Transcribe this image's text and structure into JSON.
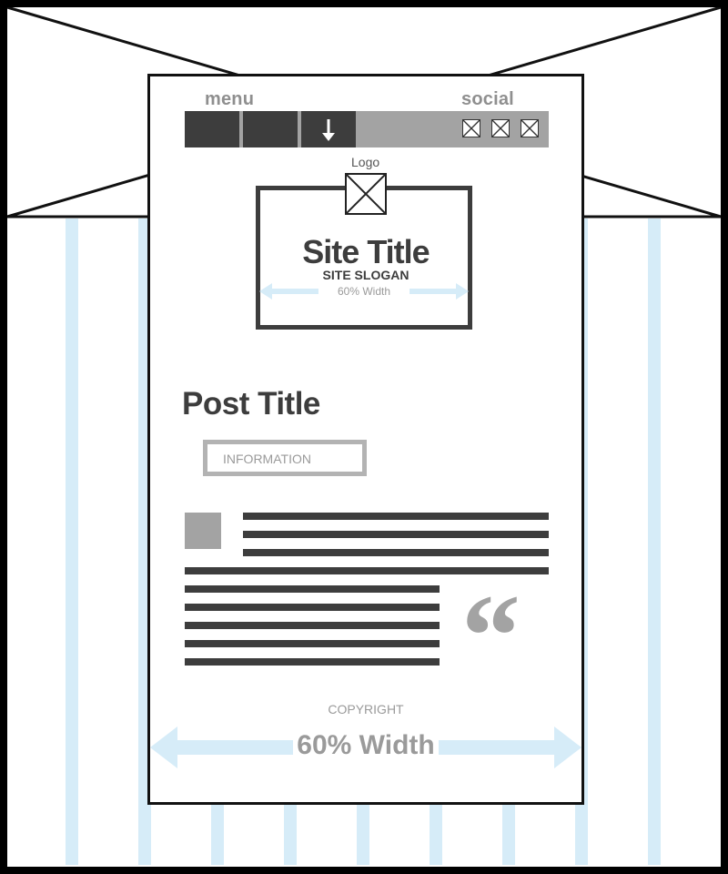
{
  "header": {
    "menu_label": "menu",
    "social_label": "social",
    "logo_caption": "Logo",
    "site_title": "Site Title",
    "site_slogan": "SITE SLOGAN",
    "header_width_label": "60% Width"
  },
  "nav": {
    "icon": "arrow-down-icon",
    "social_icons": [
      "image-placeholder-icon",
      "image-placeholder-icon",
      "image-placeholder-icon"
    ]
  },
  "post": {
    "title": "Post Title",
    "information_label": "INFORMATION",
    "quote_glyph": "“"
  },
  "footer": {
    "copyright": "COPYRIGHT",
    "width_label": "60% Width"
  },
  "colors": {
    "dark_gray": "#3d3d3d",
    "mid_gray": "#a3a3a3",
    "light_blue_guides": "#d6ecf8",
    "outline": "#111111"
  }
}
